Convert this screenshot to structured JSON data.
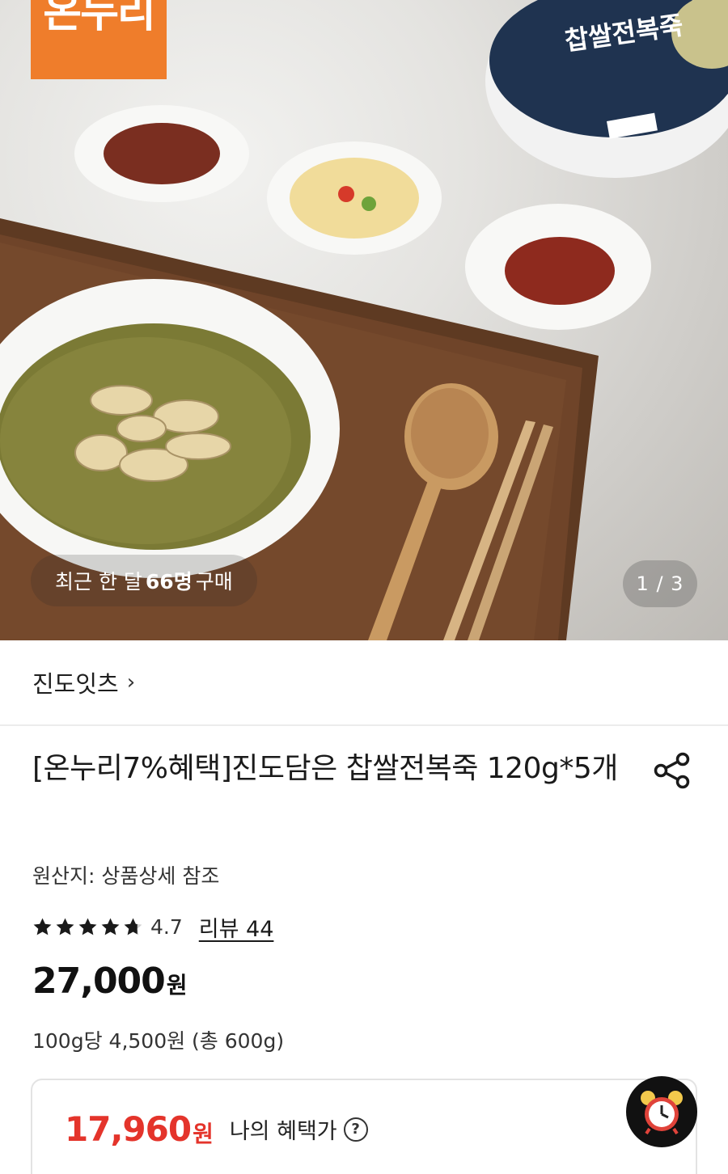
{
  "hero": {
    "logo_text": "온누리",
    "purchase_prefix": "최근 한 달",
    "purchase_count": "66명",
    "purchase_suffix": "구매",
    "counter": "1 / 3",
    "package_text": "찹쌀전복죽"
  },
  "store": {
    "name": "진도잇츠",
    "chevron": "›"
  },
  "product": {
    "title": "[온누리7%혜택]진도담은 찹쌀전복죽 120g*5개",
    "origin": "원산지: 상품상세 참조",
    "rating": "4.7",
    "stars_filled": 4.7,
    "review_label": "리뷰 44",
    "price": "27,000",
    "price_unit": "원",
    "unit_price": "100g당 4,500원 (총 600g)"
  },
  "benefit": {
    "price": "17,960",
    "unit": "원",
    "label": "나의 혜택가",
    "help": "?"
  },
  "colors": {
    "accent_red": "#e4342b",
    "logo_orange": "#ef7d2b"
  },
  "icons": {
    "share": "share-icon",
    "alarm": "alarm-clock-icon",
    "help": "question-circle-icon",
    "star": "star-icon"
  }
}
